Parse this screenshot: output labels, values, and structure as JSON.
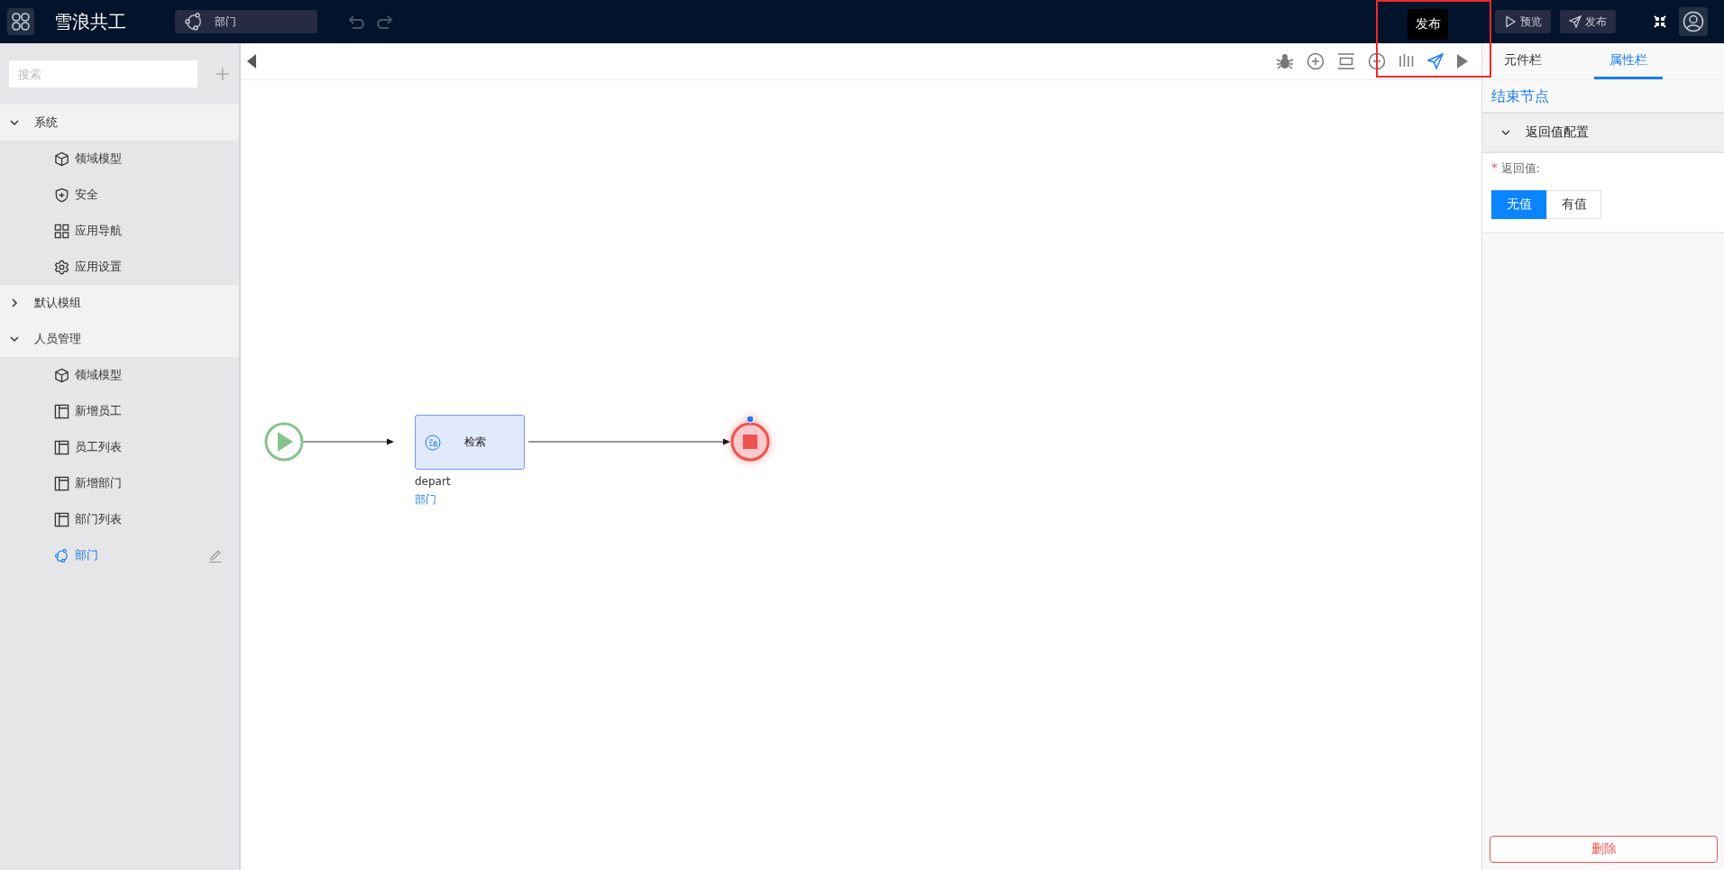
{
  "header": {
    "app_title": "雪浪共工",
    "tab": {
      "label": "部门"
    },
    "actions": [
      {
        "label": "预览",
        "kind": "preview"
      },
      {
        "label": "发布",
        "kind": "publish"
      }
    ]
  },
  "sidebar": {
    "search": {
      "placeholder": "搜索"
    },
    "groups": [
      {
        "label": "系统",
        "expanded": true,
        "children": [
          {
            "label": "领域模型",
            "kind": "model",
            "selected": false
          },
          {
            "label": "安全",
            "kind": "security",
            "selected": false
          },
          {
            "label": "应用导航",
            "kind": "navigation",
            "selected": false
          },
          {
            "label": "应用设置",
            "kind": "settings",
            "selected": false
          }
        ]
      },
      {
        "label": "默认模组",
        "expanded": false
      },
      {
        "label": "人员管理",
        "expanded": true,
        "children": [
          {
            "label": "领域模型",
            "kind": "model",
            "selected": false
          },
          {
            "label": "新增员工",
            "kind": "page",
            "selected": false
          },
          {
            "label": "员工列表",
            "kind": "page",
            "selected": false
          },
          {
            "label": "新增部门",
            "kind": "page",
            "selected": false
          },
          {
            "label": "部门列表",
            "kind": "page",
            "selected": false
          },
          {
            "label": "部门",
            "kind": "flow",
            "selected": true
          }
        ]
      }
    ]
  },
  "canvas": {
    "toolbar": [
      {
        "kind": "debug",
        "hovered": false
      },
      {
        "kind": "zoom-in",
        "hovered": false
      },
      {
        "kind": "fit",
        "hovered": false
      },
      {
        "kind": "zoom-out",
        "hovered": false
      },
      {
        "kind": "align",
        "hovered": false
      },
      {
        "kind": "publish",
        "hovered": true
      },
      {
        "kind": "run",
        "hovered": false
      }
    ],
    "tooltip": "发布",
    "task_node": {
      "label": "检索",
      "name": "depart",
      "entity": "部门"
    },
    "end_node": {
      "selected": true
    }
  },
  "right_panel": {
    "tabs": [
      {
        "label": "元件栏",
        "selected": false
      },
      {
        "label": "属性栏",
        "selected": true
      }
    ],
    "node_title": "结束节点",
    "section": {
      "title": "返回值配置",
      "expanded": true
    },
    "field": {
      "label": "返回值:",
      "required_mark": "*",
      "options": [
        {
          "label": "无值",
          "selected": true
        },
        {
          "label": "有值",
          "selected": false
        }
      ]
    },
    "delete_button": "删除"
  }
}
